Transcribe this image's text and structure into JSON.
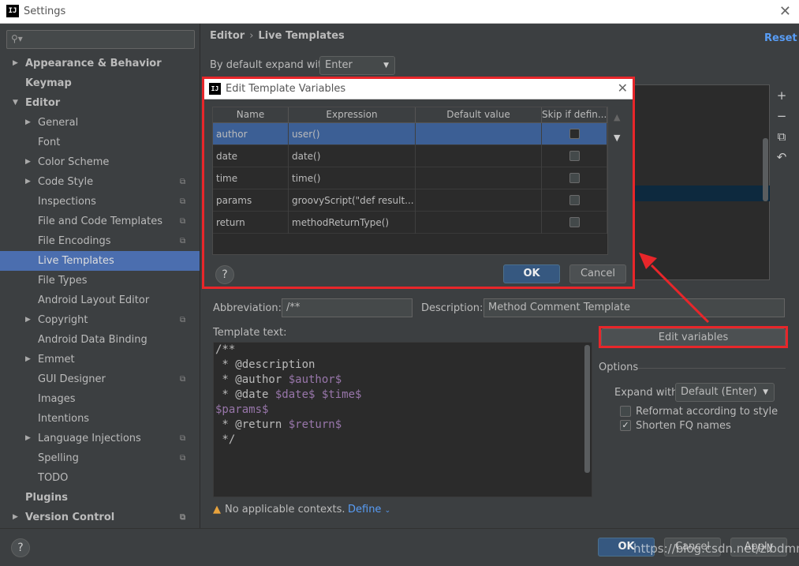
{
  "window": {
    "title": "Settings",
    "logo": "IJ"
  },
  "sidebar": {
    "search_placeholder": "",
    "items": [
      {
        "label": "Appearance & Behavior",
        "level": 0,
        "bold": true,
        "arrow": "right",
        "cfg": false
      },
      {
        "label": "Keymap",
        "level": 0,
        "bold": true,
        "arrow": "",
        "cfg": false
      },
      {
        "label": "Editor",
        "level": 0,
        "bold": true,
        "arrow": "down",
        "cfg": false
      },
      {
        "label": "General",
        "level": 1,
        "bold": false,
        "arrow": "right",
        "cfg": false
      },
      {
        "label": "Font",
        "level": 1,
        "bold": false,
        "arrow": "",
        "cfg": false
      },
      {
        "label": "Color Scheme",
        "level": 1,
        "bold": false,
        "arrow": "right",
        "cfg": false
      },
      {
        "label": "Code Style",
        "level": 1,
        "bold": false,
        "arrow": "right",
        "cfg": true
      },
      {
        "label": "Inspections",
        "level": 1,
        "bold": false,
        "arrow": "",
        "cfg": true
      },
      {
        "label": "File and Code Templates",
        "level": 1,
        "bold": false,
        "arrow": "",
        "cfg": true
      },
      {
        "label": "File Encodings",
        "level": 1,
        "bold": false,
        "arrow": "",
        "cfg": true
      },
      {
        "label": "Live Templates",
        "level": 1,
        "bold": false,
        "arrow": "",
        "cfg": false,
        "selected": true
      },
      {
        "label": "File Types",
        "level": 1,
        "bold": false,
        "arrow": "",
        "cfg": false
      },
      {
        "label": "Android Layout Editor",
        "level": 1,
        "bold": false,
        "arrow": "",
        "cfg": false
      },
      {
        "label": "Copyright",
        "level": 1,
        "bold": false,
        "arrow": "right",
        "cfg": true
      },
      {
        "label": "Android Data Binding",
        "level": 1,
        "bold": false,
        "arrow": "",
        "cfg": false
      },
      {
        "label": "Emmet",
        "level": 1,
        "bold": false,
        "arrow": "right",
        "cfg": false
      },
      {
        "label": "GUI Designer",
        "level": 1,
        "bold": false,
        "arrow": "",
        "cfg": true
      },
      {
        "label": "Images",
        "level": 1,
        "bold": false,
        "arrow": "",
        "cfg": false
      },
      {
        "label": "Intentions",
        "level": 1,
        "bold": false,
        "arrow": "",
        "cfg": false
      },
      {
        "label": "Language Injections",
        "level": 1,
        "bold": false,
        "arrow": "right",
        "cfg": true
      },
      {
        "label": "Spelling",
        "level": 1,
        "bold": false,
        "arrow": "",
        "cfg": true
      },
      {
        "label": "TODO",
        "level": 1,
        "bold": false,
        "arrow": "",
        "cfg": false
      },
      {
        "label": "Plugins",
        "level": 0,
        "bold": true,
        "arrow": "",
        "cfg": false
      },
      {
        "label": "Version Control",
        "level": 0,
        "bold": true,
        "arrow": "right",
        "cfg": true
      }
    ]
  },
  "header": {
    "crumb_parent": "Editor",
    "crumb_sep": "›",
    "crumb_current": "Live Templates",
    "reset_label": "Reset"
  },
  "expand_default": {
    "label": "By default expand with",
    "value": "Enter"
  },
  "toolbar_icons": [
    "+",
    "−",
    "⧉",
    "↶"
  ],
  "abbreviation": {
    "label": "Abbreviation:",
    "value": "/**"
  },
  "description": {
    "label": "Description:",
    "value": "Method Comment Template"
  },
  "template_text": {
    "label": "Template text:",
    "lines": [
      [
        {
          "t": "/**"
        }
      ],
      [
        {
          "t": " * @description"
        }
      ],
      [
        {
          "t": " * @author "
        },
        {
          "t": "$author$",
          "v": true
        }
      ],
      [
        {
          "t": " * @date "
        },
        {
          "t": "$date$",
          "v": true
        },
        {
          "t": " "
        },
        {
          "t": "$time$",
          "v": true
        }
      ],
      [
        {
          "t": "$params$",
          "v": true
        }
      ],
      [
        {
          "t": " * @return "
        },
        {
          "t": "$return$",
          "v": true
        }
      ],
      [
        {
          "t": " */"
        }
      ]
    ]
  },
  "edit_variables_label": "Edit variables",
  "options": {
    "label": "Options",
    "expand_with_label": "Expand with",
    "expand_with_value": "Default (Enter)",
    "reformat_label": "Reformat according to style",
    "reformat_checked": false,
    "shorten_label": "Shorten FQ names",
    "shorten_checked": true
  },
  "warning": {
    "text": "No applicable contexts.",
    "define_label": "Define"
  },
  "bottom": {
    "help": "?",
    "ok": "OK",
    "cancel": "Cancel",
    "apply": "Apply"
  },
  "watermark": "https://blog.csdn.net/zlbdmm",
  "dialog": {
    "title": "Edit Template Variables",
    "columns": [
      "Name",
      "Expression",
      "Default value",
      "Skip if defin..."
    ],
    "rows": [
      {
        "name": "author",
        "expression": "user()",
        "default": "",
        "skip": false,
        "selected": true
      },
      {
        "name": "date",
        "expression": "date()",
        "default": "",
        "skip": false
      },
      {
        "name": "time",
        "expression": "time()",
        "default": "",
        "skip": false
      },
      {
        "name": "params",
        "expression": "groovyScript(\"def result...",
        "default": "",
        "skip": false
      },
      {
        "name": "return",
        "expression": "methodReturnType()",
        "default": "",
        "skip": false
      }
    ],
    "ok": "OK",
    "cancel": "Cancel",
    "help": "?"
  },
  "colors": {
    "accent": "#4b6eaf",
    "link": "#589df6",
    "highlight": "#e8262a",
    "template_var": "#9876aa"
  }
}
